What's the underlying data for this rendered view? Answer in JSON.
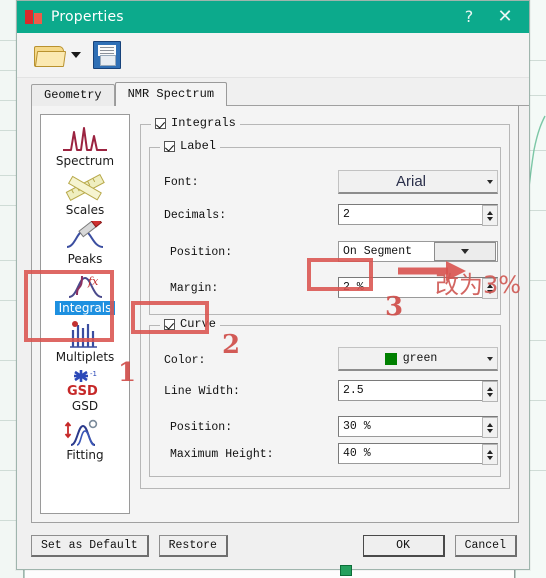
{
  "window": {
    "title": "Properties",
    "icon": "app-icon",
    "help_label": "?",
    "close_label": "✕",
    "titlebar_color": "#0caa8c"
  },
  "toolbar": {
    "open_label": "open-folder",
    "dropdown_label": "▼",
    "save_label": "save-document"
  },
  "tabs": [
    {
      "label": "Geometry",
      "active": false
    },
    {
      "label": "NMR Spectrum",
      "active": true
    }
  ],
  "sidebar": {
    "items": [
      {
        "label": "Spectrum",
        "icon": "spectrum-icon",
        "selected": false
      },
      {
        "label": "Scales",
        "icon": "scales-icon",
        "selected": false
      },
      {
        "label": "Peaks",
        "icon": "peaks-icon",
        "selected": false
      },
      {
        "label": "Integrals",
        "icon": "integrals-icon",
        "selected": true
      },
      {
        "label": "Multiplets",
        "icon": "multiplets-icon",
        "selected": false
      },
      {
        "label": "GSD",
        "icon": "gsd-icon",
        "selected": false
      },
      {
        "label": "Fitting",
        "icon": "fitting-icon",
        "selected": false
      }
    ],
    "selection_color": "#1e90e0"
  },
  "integrals_group": {
    "legend": "Integrals",
    "checked": true
  },
  "label_group": {
    "legend": "Label",
    "checked": true,
    "fields": {
      "font_label": "Font:",
      "font_value": "Arial",
      "decimals_label": "Decimals:",
      "decimals_value": "2",
      "position_label": "Position:",
      "position_value": "On Segment",
      "margin_label": "Margin:",
      "margin_value": "2 %"
    }
  },
  "curve_group": {
    "legend": "Curve",
    "checked": true,
    "fields": {
      "color_label": "Color:",
      "color_value": "green",
      "color_hex": "#008000",
      "line_width_label": "Line Width:",
      "line_width_value": "2.5",
      "position_label": "Position:",
      "position_value": "30 %",
      "max_height_label": "Maximum Height:",
      "max_height_value": "40 %"
    }
  },
  "buttons": {
    "set_as_default": "Set as Default",
    "restore": "Restore",
    "ok": "OK",
    "cancel": "Cancel"
  },
  "annotations": {
    "num1": "1",
    "num2": "2",
    "num3": "3",
    "chinese_note": "改为3%",
    "color": "#d9534f"
  }
}
